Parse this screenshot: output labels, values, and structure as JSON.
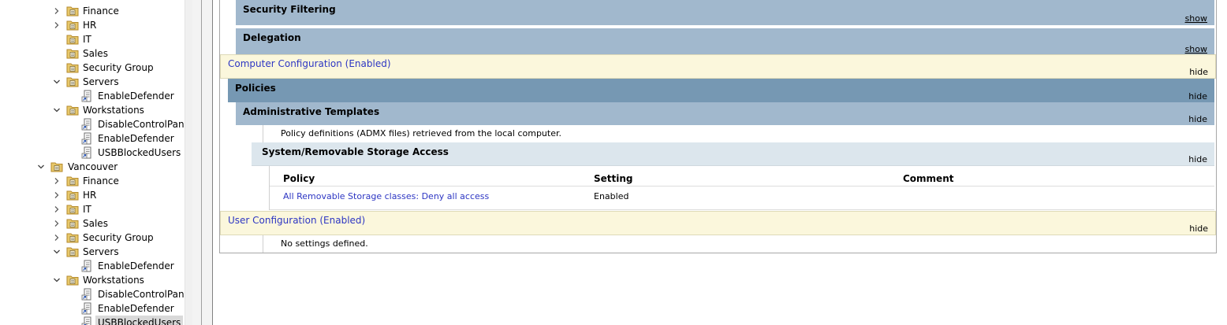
{
  "tree": {
    "items": [
      {
        "label": "Finance",
        "type": "ou",
        "expander": "collapsed"
      },
      {
        "label": "HR",
        "type": "ou",
        "expander": "collapsed"
      },
      {
        "label": "IT",
        "type": "ou",
        "expander": "none"
      },
      {
        "label": "Sales",
        "type": "ou",
        "expander": "none"
      },
      {
        "label": "Security Group",
        "type": "ou",
        "expander": "none"
      },
      {
        "label": "Servers",
        "type": "ou",
        "expander": "expanded"
      },
      {
        "label": "EnableDefender",
        "type": "gpo",
        "expander": "none"
      },
      {
        "label": "Workstations",
        "type": "ou",
        "expander": "expanded"
      },
      {
        "label": "DisableControlPanel",
        "type": "gpo",
        "expander": "none"
      },
      {
        "label": "EnableDefender",
        "type": "gpo",
        "expander": "none"
      },
      {
        "label": "USBBlockedUsers",
        "type": "gpo",
        "expander": "none"
      },
      {
        "label": "Vancouver",
        "type": "ou",
        "expander": "expanded"
      },
      {
        "label": "Finance",
        "type": "ou",
        "expander": "collapsed"
      },
      {
        "label": "HR",
        "type": "ou",
        "expander": "collapsed"
      },
      {
        "label": "IT",
        "type": "ou",
        "expander": "collapsed"
      },
      {
        "label": "Sales",
        "type": "ou",
        "expander": "collapsed"
      },
      {
        "label": "Security Group",
        "type": "ou",
        "expander": "collapsed"
      },
      {
        "label": "Servers",
        "type": "ou",
        "expander": "expanded"
      },
      {
        "label": "EnableDefender",
        "type": "gpo",
        "expander": "none"
      },
      {
        "label": "Workstations",
        "type": "ou",
        "expander": "expanded"
      },
      {
        "label": "DisableControlPanel",
        "type": "gpo",
        "expander": "none"
      },
      {
        "label": "EnableDefender",
        "type": "gpo",
        "expander": "none"
      },
      {
        "label": "USBBlockedUsers",
        "type": "gpo",
        "expander": "none",
        "selected": true
      }
    ]
  },
  "report": {
    "security_filtering": {
      "title": "Security Filtering",
      "toggle": "show"
    },
    "delegation": {
      "title": "Delegation",
      "toggle": "show"
    },
    "computer_config": {
      "title": "Computer Configuration (Enabled)",
      "toggle": "hide"
    },
    "policies": {
      "title": "Policies",
      "toggle": "hide"
    },
    "admin_templates": {
      "title": "Administrative Templates",
      "toggle": "hide"
    },
    "admx_note": "Policy definitions (ADMX files) retrieved from the local computer.",
    "removable_storage": {
      "title": "System/Removable Storage Access",
      "toggle": "hide"
    },
    "table": {
      "headers": [
        "Policy",
        "Setting",
        "Comment"
      ],
      "rows": [
        {
          "policy": "All Removable Storage classes: Deny all access",
          "setting": "Enabled",
          "comment": ""
        }
      ]
    },
    "user_config": {
      "title": "User Configuration (Enabled)",
      "toggle": "hide"
    },
    "no_settings": "No settings defined."
  },
  "colors": {
    "band_blue": "#a1b8cd",
    "band_dark_blue": "#7698b3",
    "band_light": "#dce6ed",
    "config_yellow": "#fbf7dc",
    "link_blue": "#2d36c3"
  }
}
